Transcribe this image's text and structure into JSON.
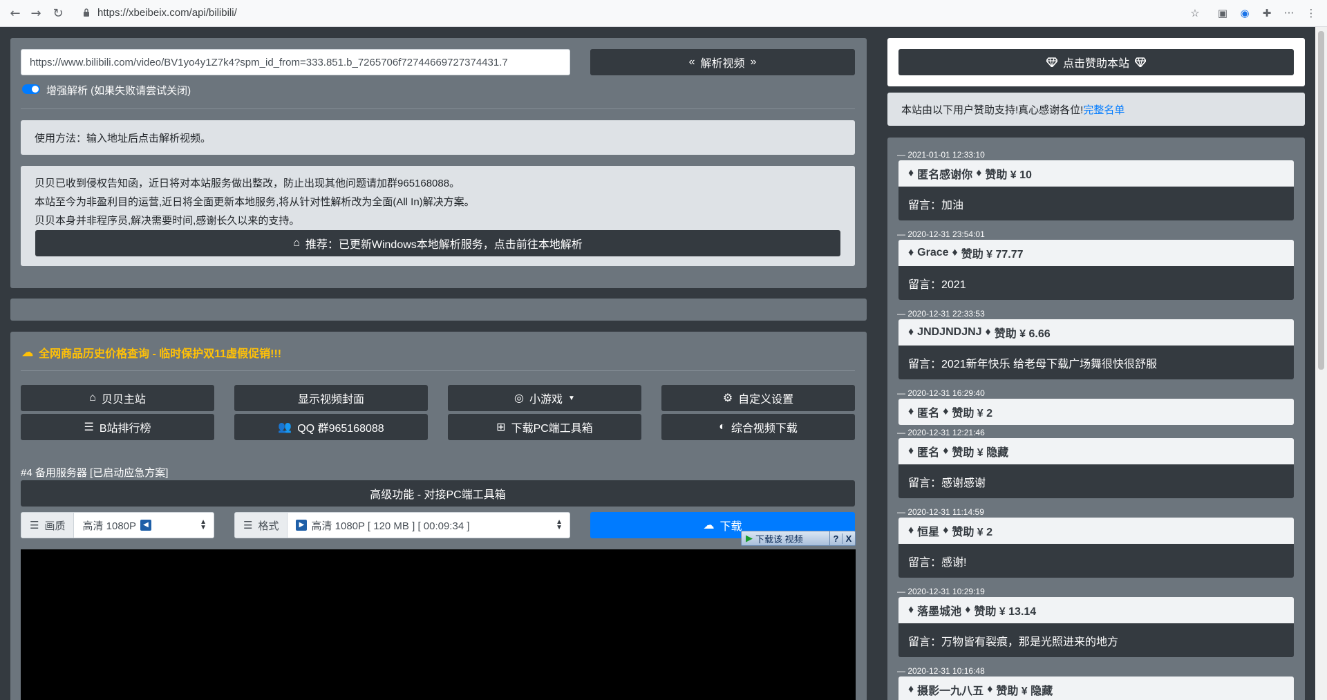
{
  "browser": {
    "url": "https://xbeibeix.com/api/bilibili/"
  },
  "parse": {
    "url_value": "https://www.bilibili.com/video/BV1yo4y1Z7k4?spm_id_from=333.851.b_7265706f72744669727374431.7",
    "parse_button": "解析视频",
    "enhance_label": "增强解析 (如果失败请尝试关闭)",
    "usage": "使用方法：输入地址后点击解析视频。",
    "notice_lines": [
      "贝贝已收到侵权告知函，近日将对本站服务做出整改，防止出现其他问题请加群965168088。",
      "本站至今为非盈利目的运营,近日将全面更新本地服务,将从针对性解析改为全面(All In)解决方案。",
      "贝贝本身并非程序员,解决需要时间,感谢长久以来的支持。"
    ],
    "recommend_button": "推荐：已更新Windows本地解析服务，点击前往本地解析"
  },
  "promo": "全网商品历史价格查询 - 临时保护双11虚假促销!!!",
  "buttons": {
    "home": "贝贝主站",
    "show_cover": "显示视频封面",
    "games": "小游戏",
    "custom_settings": "自定义设置",
    "ranking": "B站排行榜",
    "qq_group": "QQ 群965168088",
    "pc_toolbox": "下载PC端工具箱",
    "video_download": "综合视频下载"
  },
  "server_label": "#4 备用服务器 [已启动应急方案]",
  "advanced_button": "高级功能 - 对接PC端工具箱",
  "quality": {
    "label": "画质",
    "value": "高清 1080P"
  },
  "format": {
    "label": "格式",
    "value": "高清 1080P [ 120 MB ] [ 00:09:34 ]"
  },
  "download_button": "下载",
  "overlay": {
    "label": "下载该 视频",
    "help": "?",
    "close": "X"
  },
  "sidebar": {
    "sponsor_button": "点击赞助本站",
    "thanks_text": "本站由以下用户赞助支持!真心感谢各位!",
    "full_list_link": "完整名单",
    "entries": [
      {
        "date": "— 2021-01-01 12:33:10",
        "name": "匿名感谢你",
        "amount": "赞助 ¥ 10",
        "message": "留言：加油"
      },
      {
        "date": "— 2020-12-31 23:54:01",
        "name": "Grace",
        "amount": "赞助 ¥ 77.77",
        "message": "留言：2021"
      },
      {
        "date": "— 2020-12-31 22:33:53",
        "name": "JNDJNDJNJ",
        "amount": "赞助 ¥ 6.66",
        "message": "留言：2021新年快乐 给老母下载广场舞很快很舒服"
      },
      {
        "date": "— 2020-12-31 16:29:40",
        "name": "匿名",
        "amount": "赞助 ¥ 2",
        "message": ""
      },
      {
        "date": "— 2020-12-31 12:21:46",
        "name": "匿名",
        "amount": "赞助 ¥ 隐藏",
        "message": "留言：感谢感谢"
      },
      {
        "date": "— 2020-12-31 11:14:59",
        "name": "恒星",
        "amount": "赞助 ¥ 2",
        "message": "留言：感谢!"
      },
      {
        "date": "— 2020-12-31 10:29:19",
        "name": "落墨城池",
        "amount": "赞助 ¥ 13.14",
        "message": "留言：万物皆有裂痕，那是光照进来的地方"
      },
      {
        "date": "— 2020-12-31 10:16:48",
        "name": "摄影一九八五",
        "amount": "赞助 ¥ 隐藏",
        "message": ""
      }
    ]
  },
  "colors": {
    "panel": "#6c757d",
    "dark": "#343a40",
    "accent": "#007bff",
    "promo": "#ffc107"
  }
}
